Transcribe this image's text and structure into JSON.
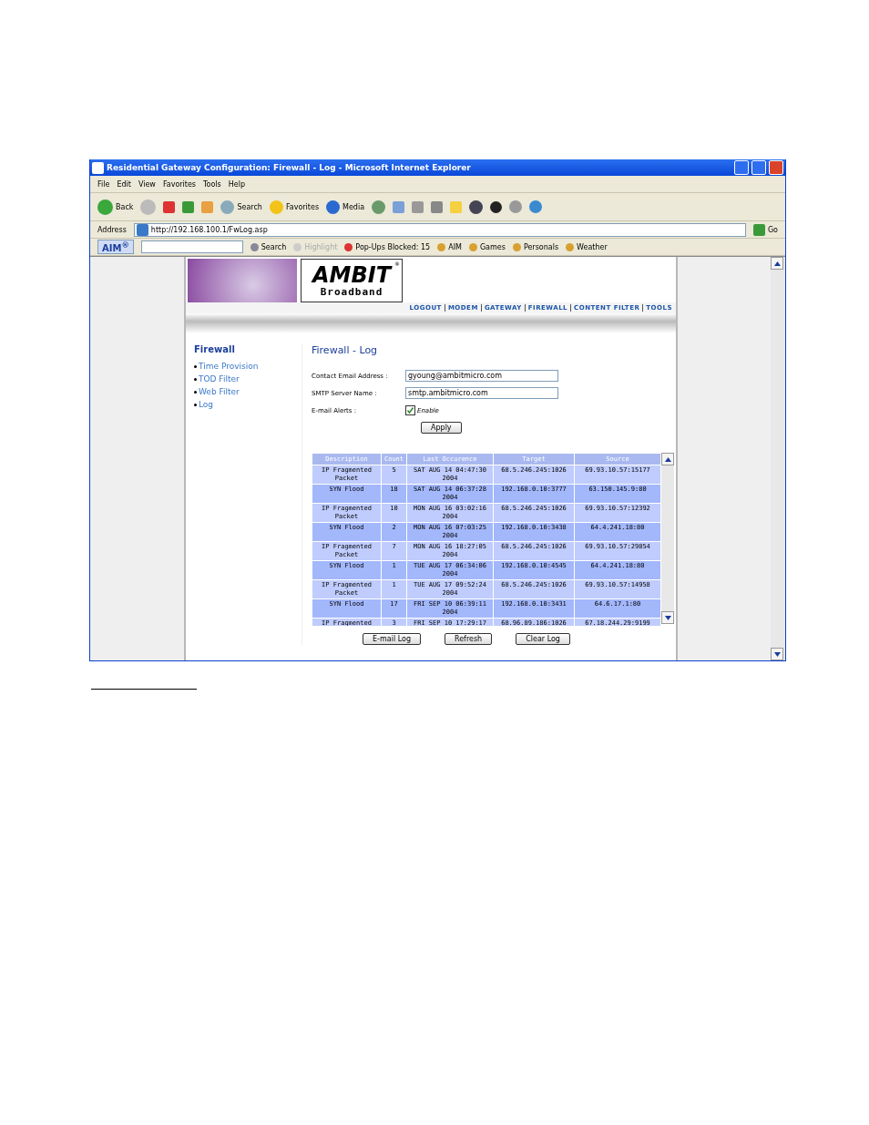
{
  "window": {
    "title": "Residential Gateway Configuration: Firewall - Log - Microsoft Internet Explorer"
  },
  "menu": [
    "File",
    "Edit",
    "View",
    "Favorites",
    "Tools",
    "Help"
  ],
  "toolbar": {
    "back": "Back",
    "search": "Search",
    "favorites": "Favorites",
    "media": "Media"
  },
  "address": {
    "label": "Address",
    "url": "http://192.168.100.1/FwLog.asp",
    "go": "Go"
  },
  "aim_bar": {
    "logo": "AIM$^{®}$",
    "search": "Search",
    "items": [
      {
        "label": "Highlight",
        "disabled": true
      },
      {
        "label": "Pop-Ups Blocked: 15",
        "disabled": false
      }
    ],
    "links": [
      "AIM",
      "Games",
      "Personals",
      "Weather"
    ]
  },
  "page": {
    "logo": {
      "brand": "AMBIT",
      "mark": "®",
      "sub": "Broadband"
    },
    "nav": [
      "LOGOUT",
      "MODEM",
      "GATEWAY",
      "FIREWALL",
      "CONTENT FILTER",
      "TOOLS"
    ],
    "sidebar": {
      "title": "Firewall",
      "items": [
        "Time Provision",
        "TOD Filter",
        "Web Filter",
        "Log"
      ]
    },
    "heading": "Firewall - Log",
    "fields": [
      {
        "label": "Contact Email Address :",
        "value": "gyoung@ambitmicro.com"
      },
      {
        "label": "SMTP Server Name :",
        "value": "smtp.ambitmicro.com"
      }
    ],
    "alerts": {
      "label": "E-mail Alerts :",
      "checkbox": "Enable",
      "checked": true
    },
    "apply": "Apply",
    "table": {
      "columns": [
        "Description",
        "Count",
        "Last Occurence",
        "Target",
        "Source"
      ],
      "rows": [
        [
          "IP Fragmented Packet",
          "5",
          "SAT AUG 14 04:47:30 2004",
          "68.5.246.245:1026",
          "69.93.10.57:15177"
        ],
        [
          "SYN Flood",
          "18",
          "SAT AUG 14 06:37:28 2004",
          "192.168.0.10:3777",
          "63.150.145.9:80"
        ],
        [
          "IP Fragmented Packet",
          "10",
          "MON AUG 16 03:02:16 2004",
          "68.5.246.245:1026",
          "69.93.10.57:12392"
        ],
        [
          "SYN Flood",
          "2",
          "MON AUG 16 07:03:25 2004",
          "192.168.0.10:3438",
          "64.4.241.18:80"
        ],
        [
          "IP Fragmented Packet",
          "7",
          "MON AUG 16 18:27:05 2004",
          "68.5.246.245:1026",
          "69.93.10.57:29854"
        ],
        [
          "SYN Flood",
          "1",
          "TUE AUG 17 06:34:06 2004",
          "192.168.0.10:4545",
          "64.4.241.18:80"
        ],
        [
          "IP Fragmented Packet",
          "1",
          "TUE AUG 17 09:52:24 2004",
          "68.5.246.245:1026",
          "69.93.10.57:14958"
        ],
        [
          "SYN Flood",
          "17",
          "FRI SEP 10 06:39:11 2004",
          "192.168.0.10:3431",
          "64.6.17.1:80"
        ],
        [
          "IP Fragmented",
          "3",
          "FRI SEP 10 17:29:17",
          "68.96.89.186:1026",
          "67.18.244.29:9199"
        ]
      ]
    },
    "buttons": [
      "E-mail Log",
      "Refresh",
      "Clear Log"
    ]
  }
}
